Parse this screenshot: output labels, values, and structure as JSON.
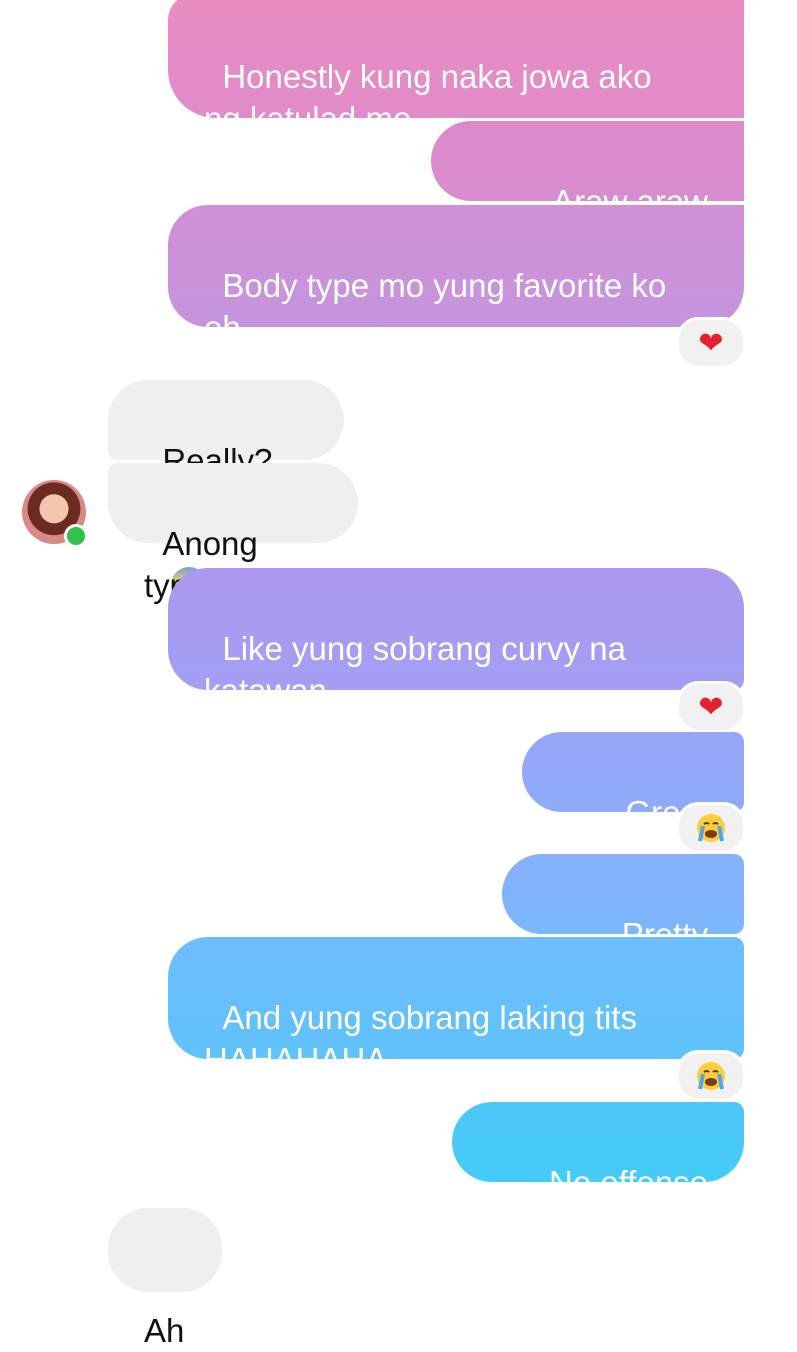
{
  "messages": {
    "m1": "Honestly kung naka jowa ako\nng katulad mo",
    "m2": "Araw araw fuck",
    "m3": "Body type mo yung favorite ko\neh",
    "m4": "Really?",
    "m5": "Anong type",
    "m6": "Like yung sobrang curvy na\nkatawan",
    "m7": "Great ass",
    "m8": "Pretty face",
    "m9": "And yung sobrang laking tits\nHAHAHAHA",
    "m10": "No offense ah",
    "m11": "Ah"
  },
  "emoji": {
    "fearful": "😨",
    "heart": "❤",
    "crying": "😭"
  },
  "colors": {
    "incoming_bg": "#efefef",
    "online": "#31c24a",
    "heart": "#e3222f"
  }
}
